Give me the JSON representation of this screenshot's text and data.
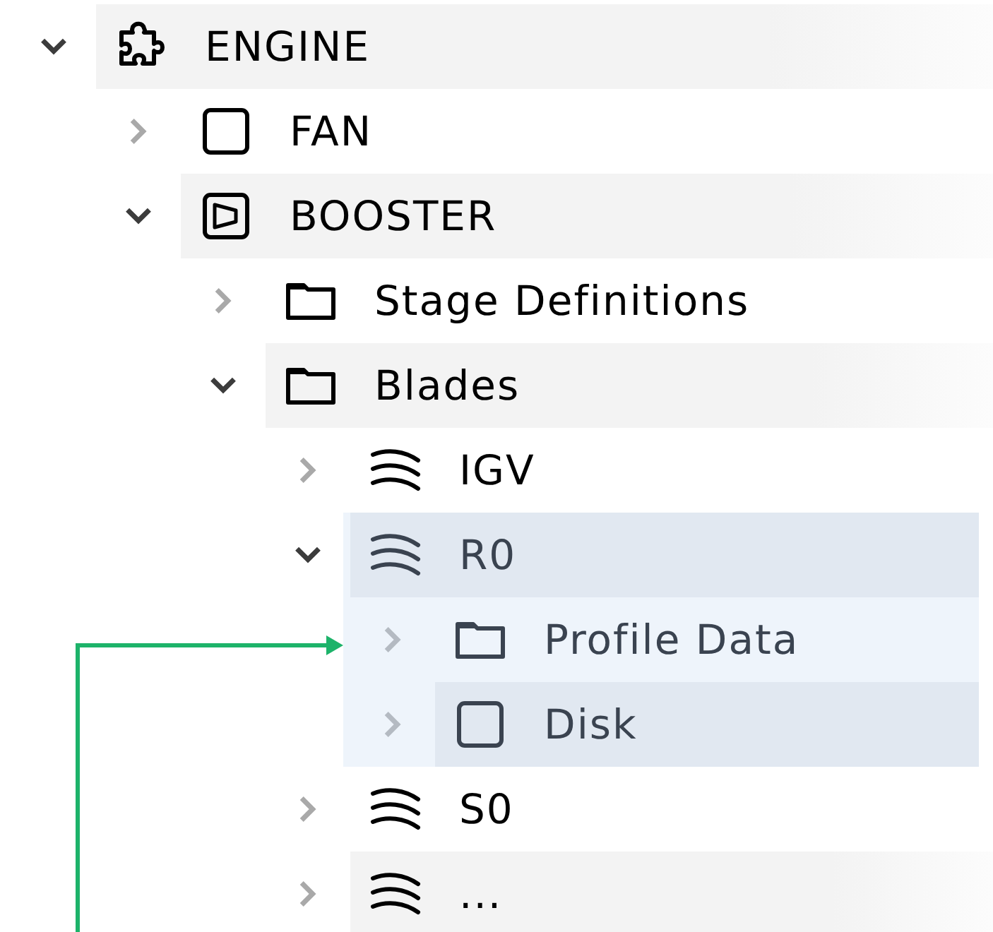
{
  "tree": [
    {
      "label": "ENGINE",
      "kind": "puzzle",
      "expanded": true,
      "highlighted": true,
      "focused": false,
      "children": [
        {
          "label": "FAN",
          "kind": "square",
          "expanded": false,
          "highlighted": false,
          "focused": false
        },
        {
          "label": "BOOSTER",
          "kind": "playbox",
          "expanded": true,
          "highlighted": true,
          "focused": false,
          "children": [
            {
              "label": "Stage Definitions",
              "kind": "folder",
              "expanded": false,
              "highlighted": false,
              "focused": false
            },
            {
              "label": "Blades",
              "kind": "folder",
              "expanded": true,
              "highlighted": true,
              "focused": false,
              "children": [
                {
                  "label": "IGV",
                  "kind": "blades",
                  "expanded": false,
                  "highlighted": false,
                  "focused": false
                },
                {
                  "label": "R0",
                  "kind": "blades",
                  "expanded": true,
                  "highlighted": true,
                  "focused": true,
                  "children": [
                    {
                      "label": "Profile Data",
                      "kind": "folder",
                      "expanded": false,
                      "highlighted": false,
                      "focused": false
                    },
                    {
                      "label": "Disk",
                      "kind": "square",
                      "expanded": false,
                      "highlighted": true,
                      "focused": false
                    }
                  ]
                },
                {
                  "label": "S0",
                  "kind": "blades",
                  "expanded": false,
                  "highlighted": false,
                  "focused": false
                },
                {
                  "label": "...",
                  "kind": "blades",
                  "expanded": false,
                  "highlighted": true,
                  "focused": false
                }
              ]
            }
          ]
        }
      ]
    }
  ],
  "annotation": {
    "kind": "arrow",
    "color": "#1db36a"
  }
}
